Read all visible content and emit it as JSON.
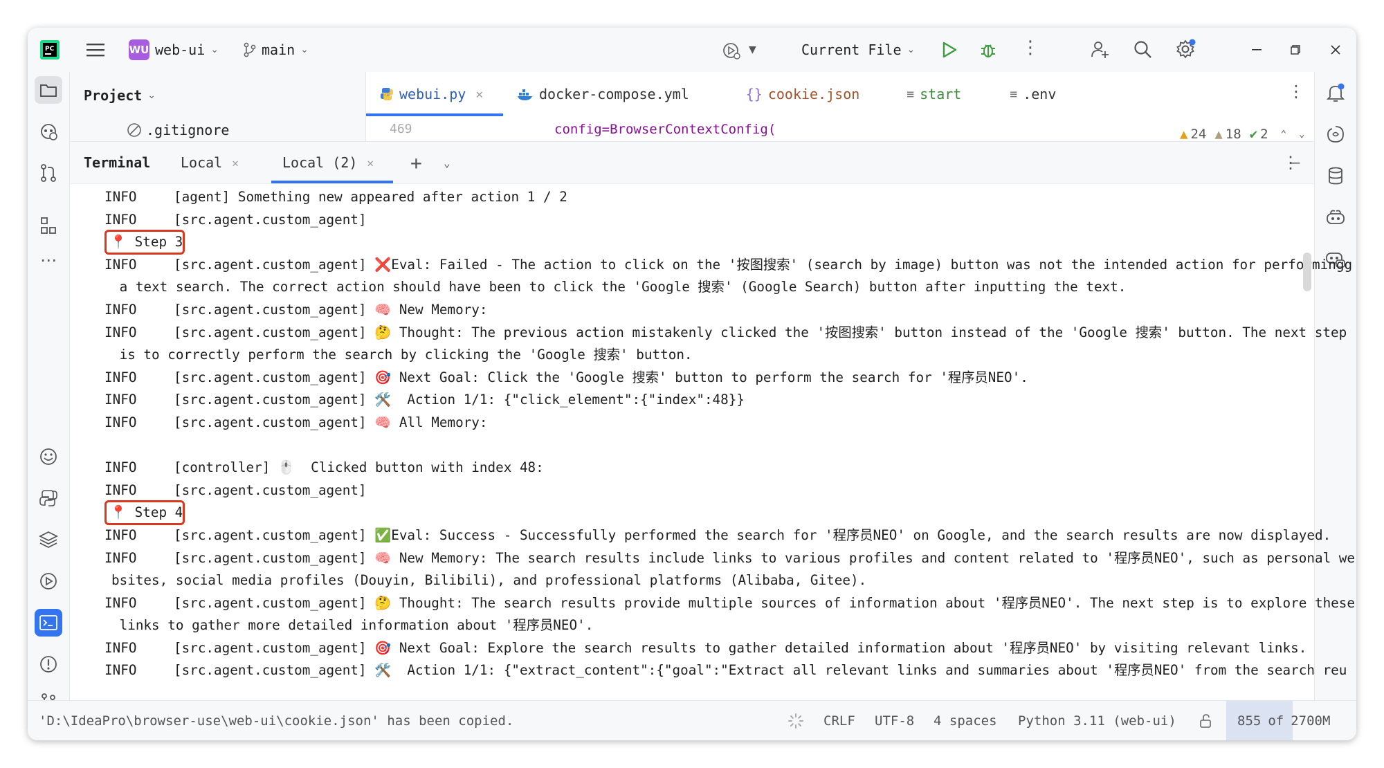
{
  "titlebar": {
    "project_badge": "WU",
    "project_name": "web-ui",
    "branch": "main",
    "run_config": "Current File"
  },
  "project_panel": {
    "title": "Project",
    "file_item": ".gitignore"
  },
  "editor": {
    "tabs": [
      {
        "label": "webui.py"
      },
      {
        "label": "docker-compose.yml"
      },
      {
        "label": "cookie.json"
      },
      {
        "label": "start"
      },
      {
        "label": ".env"
      }
    ],
    "line_number": "469",
    "code_line": "config=BrowserContextConfig(",
    "warnings": "24",
    "weak_warnings": "18",
    "checks": "2"
  },
  "terminal": {
    "title": "Terminal",
    "tabs": [
      {
        "label": "Local"
      },
      {
        "label": "Local (2)"
      }
    ],
    "lines": [
      {
        "level": "INFO",
        "text": "[agent] Something new appeared after action 1 / 2"
      },
      {
        "level": "INFO",
        "text": "[src.agent.custom_agent]"
      },
      {
        "level": "",
        "text": "📍 Step 3"
      },
      {
        "level": "INFO",
        "text": "[src.agent.custom_agent] ❌Eval: Failed - The action to click on the '按图搜索' (search by image) button was not the intended action for performingg"
      },
      {
        "level": "",
        "text": " a text search. The correct action should have been to click the 'Google 搜索' (Google Search) button after inputting the text."
      },
      {
        "level": "INFO",
        "text": "[src.agent.custom_agent] 🧠 New Memory:"
      },
      {
        "level": "INFO",
        "text": "[src.agent.custom_agent] 🤔 Thought: The previous action mistakenly clicked the '按图搜索' button instead of the 'Google 搜索' button. The next step"
      },
      {
        "level": "",
        "text": " is to correctly perform the search by clicking the 'Google 搜索' button."
      },
      {
        "level": "INFO",
        "text": "[src.agent.custom_agent] 🎯 Next Goal: Click the 'Google 搜索' button to perform the search for '程序员NEO'."
      },
      {
        "level": "INFO",
        "text": "[src.agent.custom_agent] 🛠️  Action 1/1: {\"click_element\":{\"index\":48}}"
      },
      {
        "level": "INFO",
        "text": "[src.agent.custom_agent] 🧠 All Memory:"
      },
      {
        "level": "",
        "text": ""
      },
      {
        "level": "INFO",
        "text": "[controller] 🖱️  Clicked button with index 48:"
      },
      {
        "level": "INFO",
        "text": "[src.agent.custom_agent]"
      },
      {
        "level": "",
        "text": "📍 Step 4"
      },
      {
        "level": "INFO",
        "text": "[src.agent.custom_agent] ✅Eval: Success - Successfully performed the search for '程序员NEO' on Google, and the search results are now displayed."
      },
      {
        "level": "INFO",
        "text": "[src.agent.custom_agent] 🧠 New Memory: The search results include links to various profiles and content related to '程序员NEO', such as personal we"
      },
      {
        "level": "",
        "text": "bsites, social media profiles (Douyin, Bilibili), and professional platforms (Alibaba, Gitee)."
      },
      {
        "level": "INFO",
        "text": "[src.agent.custom_agent] 🤔 Thought: The search results provide multiple sources of information about '程序员NEO'. The next step is to explore these"
      },
      {
        "level": "",
        "text": " links to gather more detailed information about '程序员NEO'."
      },
      {
        "level": "INFO",
        "text": "[src.agent.custom_agent] 🎯 Next Goal: Explore the search results to gather detailed information about '程序员NEO' by visiting relevant links."
      },
      {
        "level": "INFO",
        "text": "[src.agent.custom_agent] 🛠️  Action 1/1: {\"extract_content\":{\"goal\":\"Extract all relevant links and summaries about '程序员NEO' from the search reu"
      }
    ]
  },
  "statusbar": {
    "message": "'D:\\IdeaPro\\browser-use\\web-ui\\cookie.json' has been copied.",
    "line_sep": "CRLF",
    "encoding": "UTF-8",
    "indent": "4 spaces",
    "interpreter": "Python 3.11 (web-ui)",
    "memory_used": "855",
    "memory_of": "of",
    "memory_total": "2700M"
  },
  "colors": {
    "accent": "#3574f0",
    "highlight_box": "#d6391f",
    "badge": "#a85ce0",
    "run_green": "#3d9a3d"
  }
}
